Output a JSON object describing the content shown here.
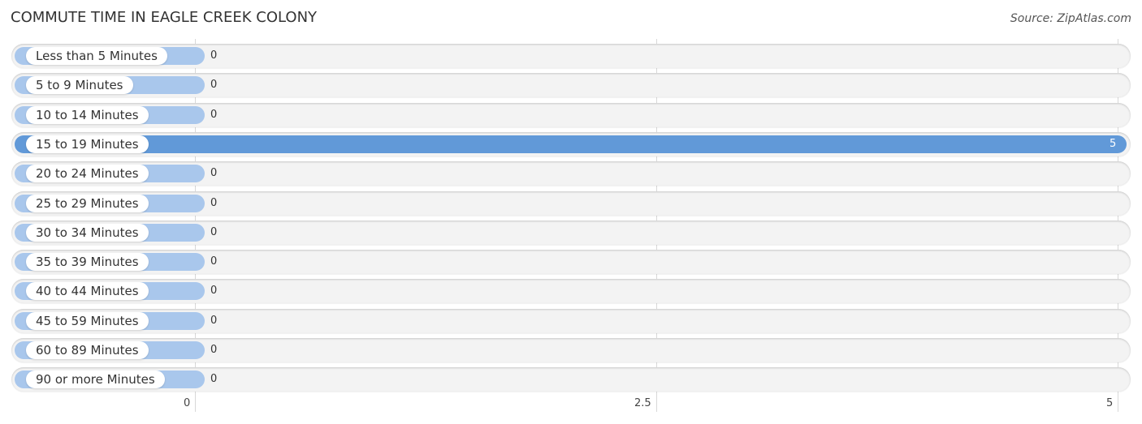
{
  "title": "COMMUTE TIME IN EAGLE CREEK COLONY",
  "source": "Source: ZipAtlas.com",
  "colors": {
    "bar_highlight": "#6199d8",
    "bar_default": "#a9c7ec",
    "track": "#f3f3f3"
  },
  "chart_data": {
    "type": "bar",
    "orientation": "horizontal",
    "title": "COMMUTE TIME IN EAGLE CREEK COLONY",
    "xlabel": "",
    "ylabel": "",
    "xlim": [
      0,
      5
    ],
    "grid": true,
    "legend": null,
    "categories": [
      "Less than 5 Minutes",
      "5 to 9 Minutes",
      "10 to 14 Minutes",
      "15 to 19 Minutes",
      "20 to 24 Minutes",
      "25 to 29 Minutes",
      "30 to 34 Minutes",
      "35 to 39 Minutes",
      "40 to 44 Minutes",
      "45 to 59 Minutes",
      "60 to 89 Minutes",
      "90 or more Minutes"
    ],
    "values": [
      0,
      0,
      0,
      5,
      0,
      0,
      0,
      0,
      0,
      0,
      0,
      0
    ],
    "value_labels": [
      "0",
      "0",
      "0",
      "5",
      "0",
      "0",
      "0",
      "0",
      "0",
      "0",
      "0",
      "0"
    ],
    "x_ticks": [
      0,
      2.5,
      5
    ],
    "x_tick_labels": [
      "0",
      "2.5",
      "5"
    ]
  }
}
